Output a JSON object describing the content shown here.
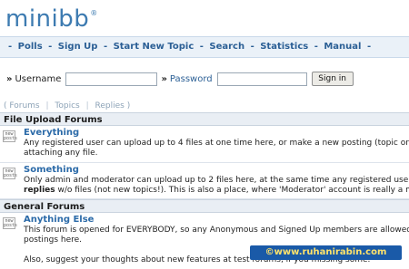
{
  "logo": {
    "text": "minibb",
    "reg": "®"
  },
  "nav": {
    "items": [
      "Polls",
      "Sign Up",
      "Start New Topic",
      "Search",
      "Statistics",
      "Manual"
    ],
    "dash": "-"
  },
  "login": {
    "raquo": "»",
    "username_label": "Username",
    "username_value": "",
    "password_label": "Password",
    "password_value": "",
    "submit_label": "Sign in"
  },
  "tabs": {
    "open": "(",
    "forums": "Forums",
    "topics": "Topics",
    "replies": "Replies",
    "pipe": "|",
    "close": ")"
  },
  "sections": [
    {
      "title": "File Upload Forums",
      "forums": [
        {
          "name": "Everything",
          "desc_line1": "Any registered user can upload up to 4 files at one time here, or make a new posting (topic or reply) without",
          "desc_line2": "attaching any file."
        },
        {
          "name": "Something",
          "desc_line1": "Only admin and moderator can upload up to 2 files here, at the same time any registered user can post new topics or",
          "desc_line2_bold": "replies",
          "desc_line2": " w/o files (not new topics!). This is also a place, where 'Moderator' account is really a moderator!"
        }
      ]
    },
    {
      "title": "General Forums",
      "forums": [
        {
          "name": "Anything Else",
          "desc_line1": "This forum is opened for EVERYBODY, so any Anonymous and Signed Up members are allowed to start new topics and",
          "desc_line2": "postings here.",
          "desc_line3": "Also, suggest your thoughts about new features at test forums, if you missing some."
        }
      ]
    }
  ],
  "forum_icon": "forum-file-icon",
  "forum_icon_text": "new\nposts",
  "watermark": "©www.ruhanirabin.com",
  "colors": {
    "accent": "#2b6aa8",
    "nav_bg": "#eaf1f8",
    "section_bg": "#e9eef4",
    "watermark_bg": "#1a5aa8",
    "watermark_text": "#ffe36b"
  }
}
